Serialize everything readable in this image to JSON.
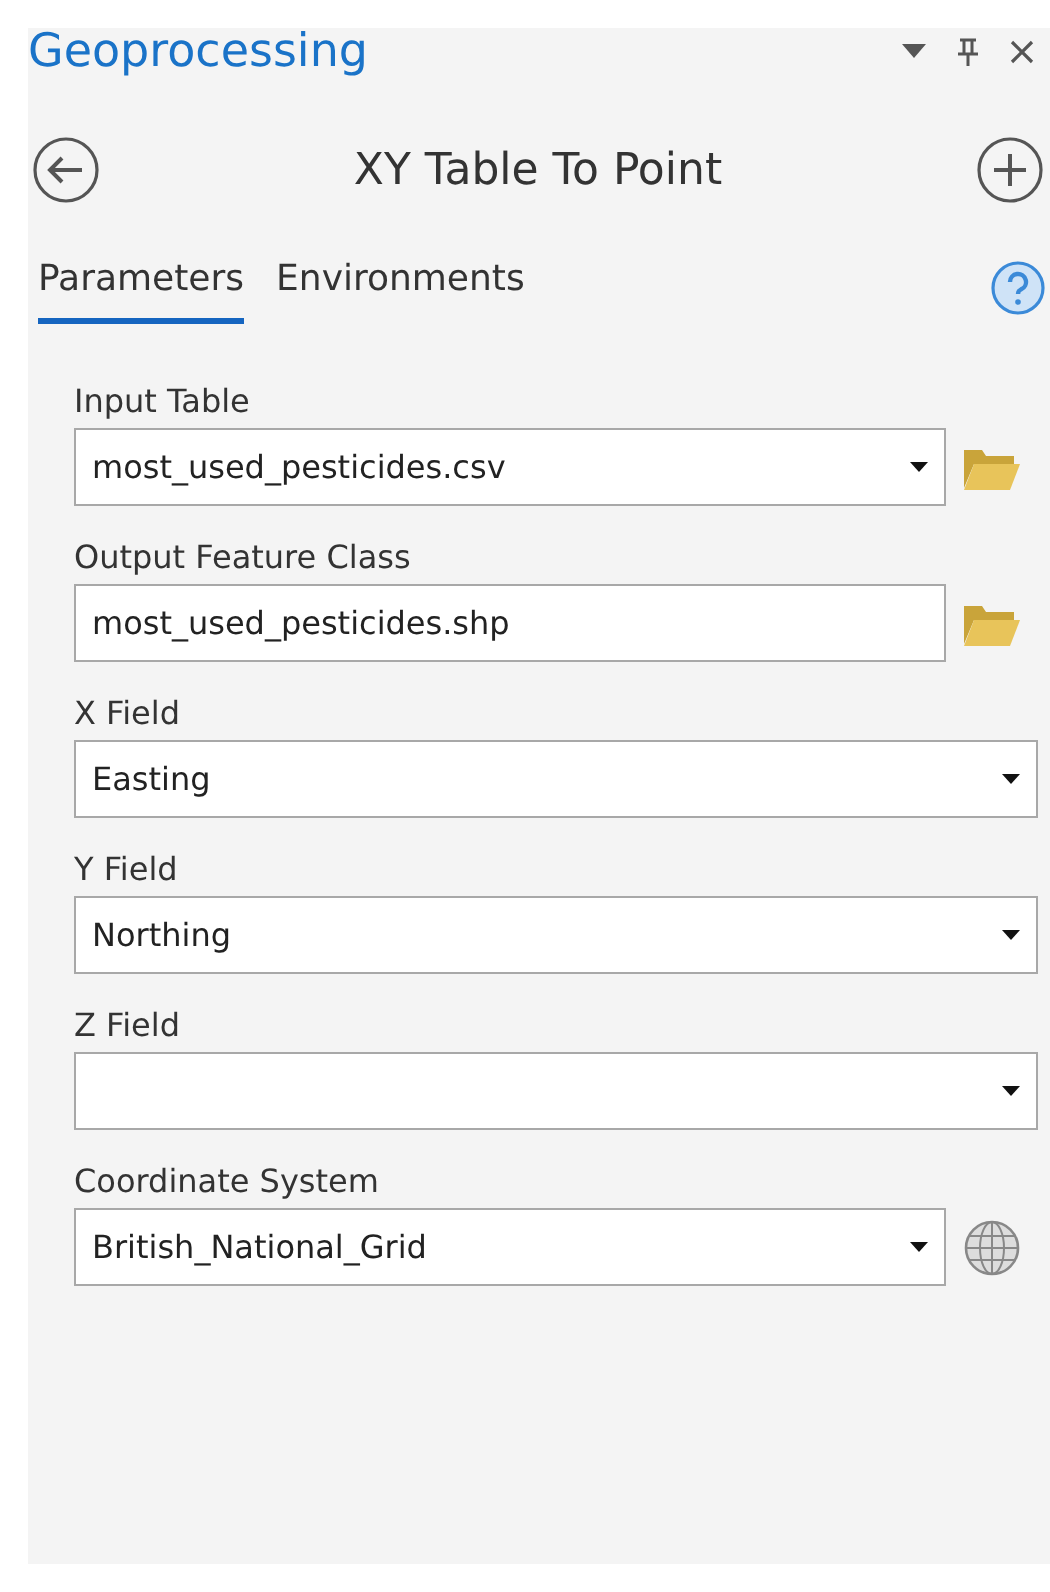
{
  "pane": {
    "title": "Geoprocessing"
  },
  "tool": {
    "title": "XY Table To Point"
  },
  "tabs": [
    {
      "label": "Parameters",
      "selected": true
    },
    {
      "label": "Environments",
      "selected": false
    }
  ],
  "parameters": [
    {
      "label": "Input Table",
      "value": "most_used_pesticides.csv",
      "kind": "dataset"
    },
    {
      "label": "Output Feature Class",
      "value": "most_used_pesticides.shp",
      "kind": "output"
    },
    {
      "label": "X Field",
      "value": "Easting",
      "kind": "field"
    },
    {
      "label": "Y Field",
      "value": "Northing",
      "kind": "field"
    },
    {
      "label": "Z Field",
      "kind": "field"
    },
    {
      "label": "Coordinate System",
      "value": "British_National_Grid",
      "kind": "projection"
    }
  ]
}
